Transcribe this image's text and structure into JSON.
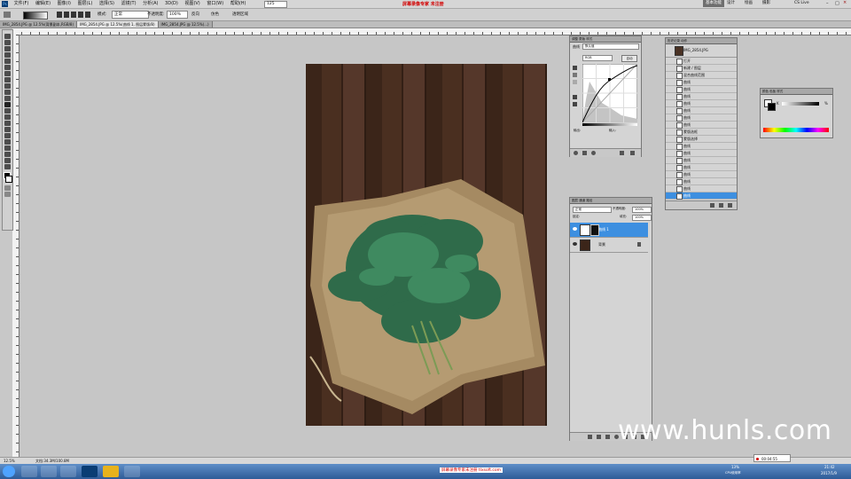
{
  "menubar": {
    "app_icon": "Ps",
    "items": [
      "文件(F)",
      "编辑(E)",
      "图像(I)",
      "图层(L)",
      "选择(S)",
      "滤镜(T)",
      "分析(A)",
      "3D(D)",
      "视图(V)",
      "窗口(W)",
      "帮助(H)"
    ],
    "zoom_value": "125",
    "center_banner": "屏幕录像专家 未注册",
    "workspace_buttons": [
      "基本功能",
      "设计",
      "绘画",
      "摄影"
    ],
    "cslive": "CS Live"
  },
  "options": {
    "mode_label": "模式:",
    "mode_value": "正常",
    "opacity_label": "不透明度:",
    "opacity_value": "100%",
    "check_reverse": "反向",
    "check_dither": "仿色",
    "check_transparency": "透明区域"
  },
  "tabs": [
    {
      "label": "IMG_2854.JPG @ 12.5%(背景副本,RGB/8)"
    },
    {
      "label": "IMG_2854.JPG @ 12.5%(曲线 1, 图层蒙版/8)"
    },
    {
      "label": "IMG_2854.JPG @ 12.5%(...)"
    }
  ],
  "adjust_panel": {
    "tabs": [
      "调整",
      "蒙版",
      "样式"
    ],
    "preset_label": "曲线",
    "preset_value": "默认值",
    "channel_value": "RGB",
    "auto_button": "自动",
    "output_label": "输出:",
    "input_label": "输入:"
  },
  "history_panel": {
    "tabs": [
      "历史记录",
      "动作"
    ],
    "snapshot": "IMG_2854.JPG",
    "items": [
      "打开",
      "新建 / 图层",
      "混合曲线范围",
      "曲线",
      "曲线",
      "曲线",
      "曲线",
      "曲线",
      "曲线",
      "曲线",
      "蒙版选框",
      "蒙版选择",
      "曲线",
      "曲线",
      "曲线",
      "曲线",
      "曲线",
      "曲线",
      "曲线",
      "曲线"
    ],
    "selected_index": 19
  },
  "color_panel": {
    "tabs": [
      "颜色",
      "色板",
      "样式"
    ],
    "k_label": "K",
    "k_value": "%"
  },
  "layers_panel": {
    "tabs": [
      "图层",
      "通道",
      "路径"
    ],
    "blend_value": "正常",
    "opacity_label": "不透明度:",
    "opacity_value": "100%",
    "lock_label": "锁定:",
    "fill_label": "填充:",
    "fill_value": "100%",
    "layers": [
      {
        "name": "曲线 1",
        "selected": true
      },
      {
        "name": "背景",
        "selected": false
      }
    ]
  },
  "status": {
    "zoom": "12.5%",
    "doc": "文档:34.3M/100.8M"
  },
  "watermark": "www.hunls.com",
  "taskbar": {
    "bottom_banner": "屏幕录像专家未注册 tlxsoft.com",
    "record_time": "00:04:55",
    "cpu": "13%",
    "cpu_label": "CPU使用率",
    "clock": "21:42",
    "date": "2017/1/9"
  },
  "colors": {
    "selection": "#3d8fe0",
    "banner_red": "#d20000"
  }
}
